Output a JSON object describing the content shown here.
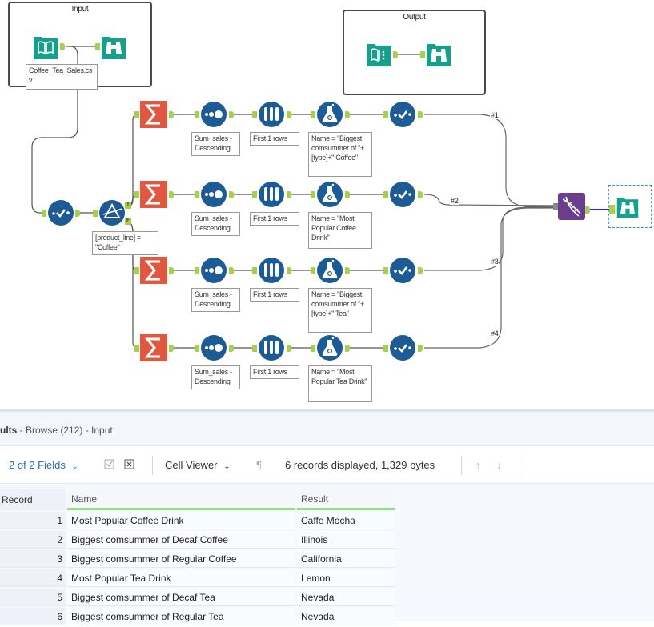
{
  "canvas": {
    "containers": [
      {
        "title": "Input"
      },
      {
        "title": "Output"
      }
    ],
    "input_annotation": "Coffee_Tea_Sales.csv",
    "filter_annotation": "[product_line] = \"Coffee\"",
    "filter_anchor_true": "T",
    "filter_anchor_false": "F",
    "rows": [
      {
        "sort_annotation": "Sum_sales - Descending",
        "sample_annotation": "First 1 rows",
        "formula_annotation": "Name = \"Biggest comsummer of \"+[type]+\" Coffee\"",
        "wire_label": "#1"
      },
      {
        "sort_annotation": "Sum_sales - Descending",
        "sample_annotation": "First 1 rows",
        "formula_annotation": "Name = \"Most Popular Coffee Drink\"",
        "wire_label": "#2"
      },
      {
        "sort_annotation": "Sum_sales - Descending",
        "sample_annotation": "First 1 rows",
        "formula_annotation": "Name = \"Biggest comsummer of \"+[type]+\" Tea\"",
        "wire_label": "#3"
      },
      {
        "sort_annotation": "Sum_sales - Descending",
        "sample_annotation": "First 1 rows",
        "formula_annotation": "Name = \"Most Popular Tea Drink\"",
        "wire_label": "#4"
      }
    ],
    "colors": {
      "io_green": "#14a08a",
      "prep_blue": "#1c5b94",
      "summarize_orange": "#e0583f",
      "union_purple": "#6b3d8f",
      "anchor_green": "#a6d04c",
      "selected_wire": "#2a2ae0"
    }
  },
  "results": {
    "title_bold": "ults",
    "title_rest": " - Browse (212) - Input",
    "toolbar": {
      "fields_label": "2 of 2 Fields",
      "cell_viewer_label": "Cell Viewer",
      "status": "6 records displayed, 1,329 bytes"
    },
    "columns": [
      "Record",
      "Name",
      "Result"
    ],
    "rows": [
      {
        "record": "1",
        "name": "Most Popular Coffee Drink",
        "result": "Caffe Mocha"
      },
      {
        "record": "2",
        "name": "Biggest comsummer of Decaf Coffee",
        "result": "Illinois"
      },
      {
        "record": "3",
        "name": "Biggest comsummer of Regular Coffee",
        "result": "California"
      },
      {
        "record": "4",
        "name": "Most Popular Tea Drink",
        "result": "Lemon"
      },
      {
        "record": "5",
        "name": "Biggest comsummer of Decaf Tea",
        "result": "Nevada"
      },
      {
        "record": "6",
        "name": "Biggest comsummer of Regular Tea",
        "result": "Nevada"
      }
    ]
  }
}
